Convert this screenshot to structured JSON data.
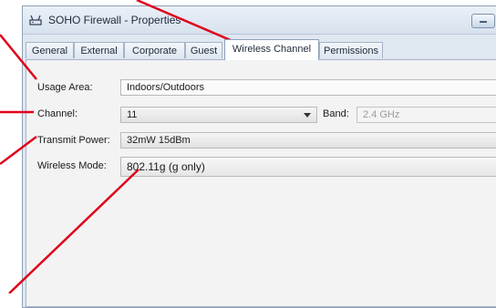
{
  "window": {
    "title": "SOHO Firewall - Properties"
  },
  "tabs": [
    {
      "label": "General",
      "active": false
    },
    {
      "label": "External",
      "active": false
    },
    {
      "label": "Corporate",
      "active": false
    },
    {
      "label": "Guest",
      "active": false
    },
    {
      "label": "Wireless Channel",
      "active": true
    },
    {
      "label": "Permissions",
      "active": false
    }
  ],
  "form": {
    "usage_area": {
      "label": "Usage Area:",
      "value": "Indoors/Outdoors"
    },
    "channel": {
      "label": "Channel:",
      "value": "11"
    },
    "band": {
      "label": "Band:",
      "value": "2.4 GHz"
    },
    "transmit_power": {
      "label": "Transmit Power:",
      "value": "32mW 15dBm"
    },
    "wireless_mode": {
      "label": "Wireless Mode:",
      "value": "802.11g (g only)"
    }
  },
  "annotation_color": "#e0001a",
  "icons": {
    "title": "router-icon",
    "minimize": "minimize-icon",
    "dropdown": "chevron-down-icon"
  }
}
